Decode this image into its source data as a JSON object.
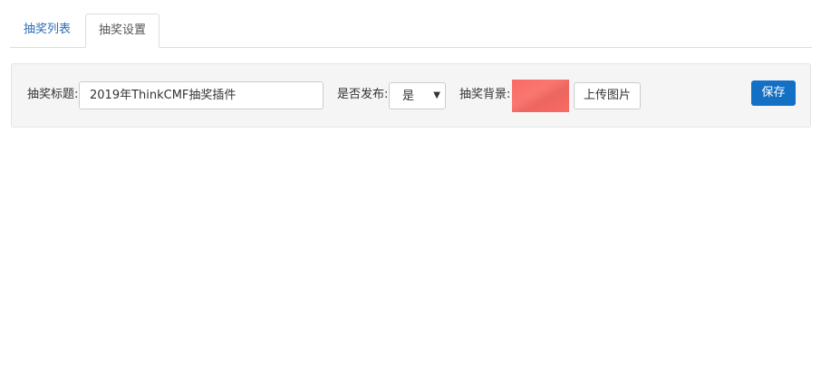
{
  "tabs": {
    "list_label": "抽奖列表",
    "settings_label": "抽奖设置"
  },
  "form": {
    "title_label": "抽奖标题:",
    "title_value": "2019年ThinkCMF抽奖插件",
    "publish_label": "是否发布:",
    "publish_value": "是",
    "background_label": "抽奖背景:",
    "upload_label": "上传图片",
    "save_label": "保存"
  },
  "colors": {
    "accent": "#1470c4",
    "link": "#2a6db3",
    "background_preview": "#f96b64"
  }
}
